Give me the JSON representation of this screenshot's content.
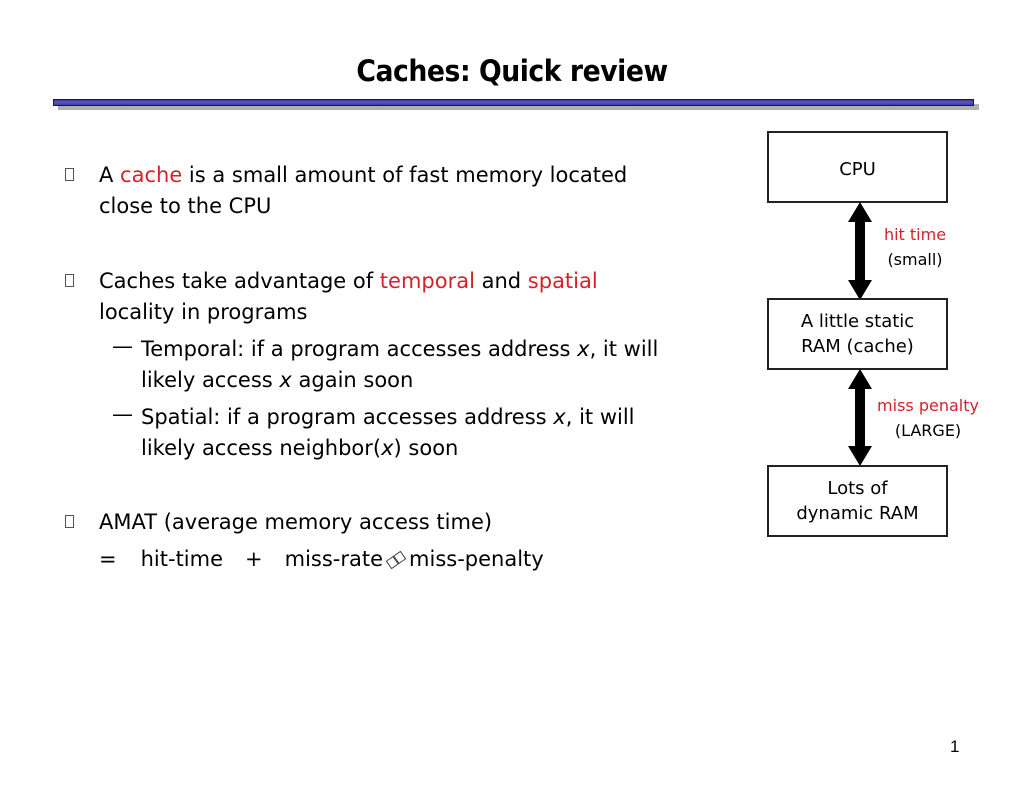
{
  "slide": {
    "title": "Caches: Quick review",
    "page_number": "1"
  },
  "bullets": [
    {
      "line1": [
        {
          "text": "A ",
          "red": false
        },
        {
          "text": "cache",
          "red": true
        },
        {
          "text": " is a small amount of fast memory located",
          "red": false
        }
      ],
      "line2": "close to the CPU"
    },
    {
      "line1": [
        {
          "text": "Caches take advantage of ",
          "red": false
        },
        {
          "text": "temporal",
          "red": true
        },
        {
          "text": " and ",
          "red": false
        },
        {
          "text": "spatial",
          "red": true
        }
      ],
      "line2": "locality in programs",
      "sub": [
        {
          "dash": "—",
          "line1a": "Temporal: if a program accesses address ",
          "var": "x",
          "line1b": ", it will",
          "line2a": "likely access ",
          "var2": "x",
          "line2b": " again soon"
        },
        {
          "dash": "—",
          "line1a": "Spatial: if a program accesses address ",
          "var": "x",
          "line1b": ", it will",
          "line2a": "likely access neighbor(",
          "var2": "x",
          "line2b": ") soon"
        }
      ]
    },
    {
      "line1": [
        {
          "text": "AMAT (average memory access time)",
          "red": false
        }
      ],
      "formula": {
        "eq": "=",
        "term1": "hit-time",
        "plus": "+",
        "term2": "miss-rate",
        "times_icon": "multiply-icon",
        "term3": "miss-penalty"
      }
    }
  ],
  "diagram": {
    "boxes": [
      "CPU",
      "A little static\nRAM (cache)",
      "Lots of\ndynamic RAM"
    ],
    "box_lines": [
      [
        "CPU"
      ],
      [
        "A little static",
        "RAM (cache)"
      ],
      [
        "Lots of",
        "dynamic RAM"
      ]
    ],
    "arrows": [
      {
        "label": "hit time",
        "sublabel": "(small)"
      },
      {
        "label": "miss penalty",
        "sublabel": "(LARGE)"
      }
    ],
    "label_color": "#d4222a"
  }
}
